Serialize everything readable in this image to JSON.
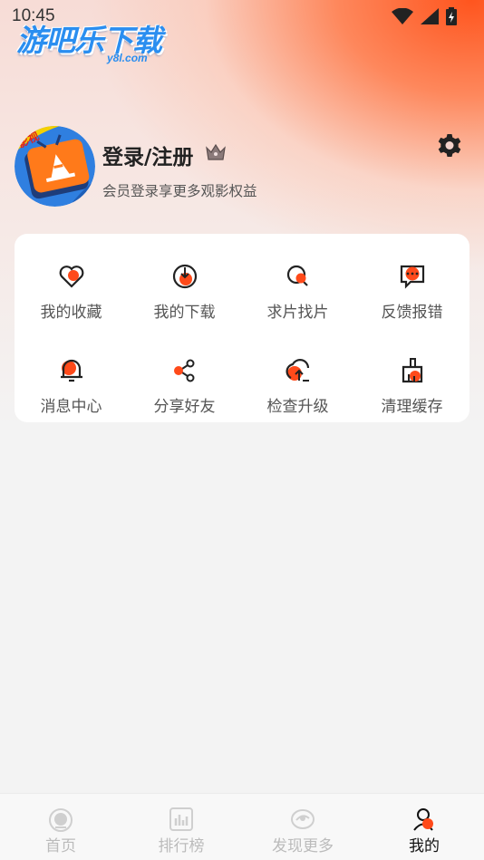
{
  "status_bar": {
    "time": "10:45"
  },
  "watermark": {
    "text": "游吧乐下载",
    "sub": "y8l.com"
  },
  "profile": {
    "login_label": "登录/注册",
    "subtitle": "会员登录享更多观影权益"
  },
  "menu": {
    "items": [
      {
        "label": "我的收藏",
        "icon": "heart-icon"
      },
      {
        "label": "我的下载",
        "icon": "download-icon"
      },
      {
        "label": "求片找片",
        "icon": "search-film-icon"
      },
      {
        "label": "反馈报错",
        "icon": "feedback-icon"
      },
      {
        "label": "消息中心",
        "icon": "bell-icon"
      },
      {
        "label": "分享好友",
        "icon": "share-icon"
      },
      {
        "label": "检查升级",
        "icon": "upgrade-icon"
      },
      {
        "label": "清理缓存",
        "icon": "broom-icon"
      }
    ]
  },
  "tabs": [
    {
      "label": "首页",
      "icon": "home-icon",
      "active": false
    },
    {
      "label": "排行榜",
      "icon": "ranking-icon",
      "active": false
    },
    {
      "label": "发现更多",
      "icon": "discover-icon",
      "active": false
    },
    {
      "label": "我的",
      "icon": "profile-icon",
      "active": true
    }
  ],
  "colors": {
    "accent": "#ff4a1a",
    "inactive_tab": "#bbbbbb",
    "active_tab": "#111111"
  }
}
